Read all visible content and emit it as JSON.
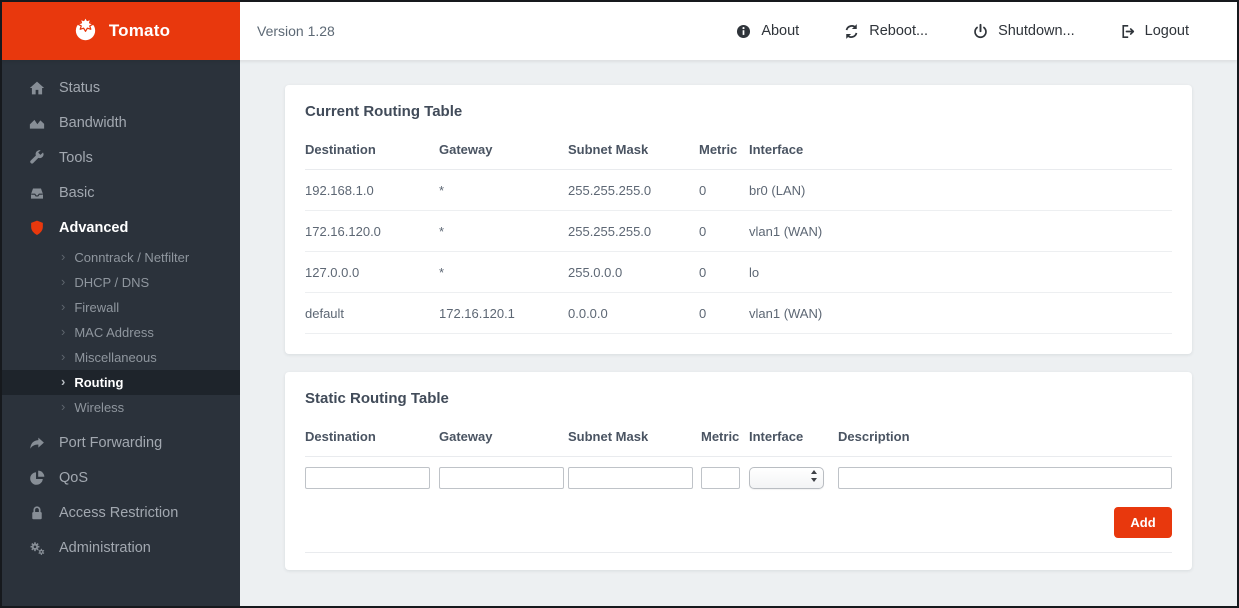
{
  "window": {
    "brand": "Tomato",
    "version_label": "Version 1.28",
    "nav": {
      "about": "About",
      "reboot": "Reboot...",
      "shutdown": "Shutdown...",
      "logout": "Logout"
    }
  },
  "sidebar": {
    "items": [
      {
        "label": "Status"
      },
      {
        "label": "Bandwidth"
      },
      {
        "label": "Tools"
      },
      {
        "label": "Basic"
      },
      {
        "label": "Advanced",
        "active": true,
        "children": [
          "Conntrack / Netfilter",
          "DHCP / DNS",
          "Firewall",
          "MAC Address",
          "Miscellaneous",
          "Routing",
          "Wireless"
        ],
        "active_child": "Routing"
      },
      {
        "label": "Port Forwarding"
      },
      {
        "label": "QoS"
      },
      {
        "label": "Access Restriction"
      },
      {
        "label": "Administration"
      }
    ]
  },
  "current_routing": {
    "title": "Current Routing Table",
    "columns": [
      "Destination",
      "Gateway",
      "Subnet Mask",
      "Metric",
      "Interface"
    ],
    "rows": [
      [
        "192.168.1.0",
        "*",
        "255.255.255.0",
        "0",
        "br0 (LAN)"
      ],
      [
        "172.16.120.0",
        "*",
        "255.255.255.0",
        "0",
        "vlan1 (WAN)"
      ],
      [
        "127.0.0.0",
        "*",
        "255.0.0.0",
        "0",
        "lo"
      ],
      [
        "default",
        "172.16.120.1",
        "0.0.0.0",
        "0",
        "vlan1 (WAN)"
      ]
    ]
  },
  "static_routing": {
    "title": "Static Routing Table",
    "columns": [
      "Destination",
      "Gateway",
      "Subnet Mask",
      "Metric",
      "Interface",
      "Description"
    ],
    "inputs": {
      "destination": "",
      "gateway": "",
      "subnet_mask": "",
      "metric": "",
      "interface_selected": "",
      "description": ""
    },
    "add_label": "Add"
  },
  "colors": {
    "accent": "#e8380d",
    "sidebar_bg": "#2b323b",
    "sidebar_active_bg": "#1e242b",
    "page_bg": "#edf0f2"
  }
}
